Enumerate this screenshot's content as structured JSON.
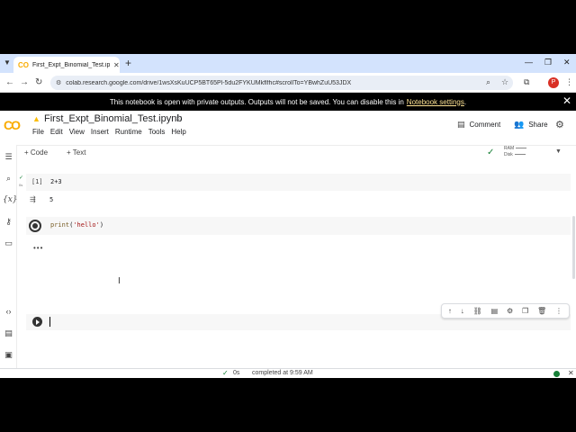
{
  "browser": {
    "tab_title": "First_Expt_Binomial_Test.ipynb",
    "favicon": "CO",
    "url": "colab.research.google.com/drive/1wsXsKuUCP5BT65Pl-5du2FYKUMkflfhc#scrollTo=YBwhZuU53JDX",
    "profile_initial": "P"
  },
  "banner": {
    "text": "This notebook is open with private outputs. Outputs will not be saved. You can disable this in",
    "link": "Notebook settings",
    "period": "."
  },
  "colab": {
    "logo": "CO",
    "title": "First_Expt_Binomial_Test.ipynb",
    "menu": [
      "File",
      "Edit",
      "View",
      "Insert",
      "Runtime",
      "Tools",
      "Help"
    ],
    "comment_label": "Comment",
    "share_label": "Share"
  },
  "toolbar": {
    "code_label": "+ Code",
    "text_label": "+ Text",
    "ram_label": "RAM",
    "disk_label": "Disk"
  },
  "cells": [
    {
      "exec": "[1]",
      "code": "2+3",
      "ran_time": "0s",
      "output": "5"
    },
    {
      "code_fn": "print",
      "code_open": "(",
      "code_str": "'hello'",
      "code_close": ")"
    }
  ],
  "running_dots": "•••",
  "status": {
    "time": "0s",
    "message": "completed at 9:59 AM"
  },
  "colors": {
    "accent": "#f9ab00",
    "success": "#188038",
    "banner_link": "#fde293"
  }
}
